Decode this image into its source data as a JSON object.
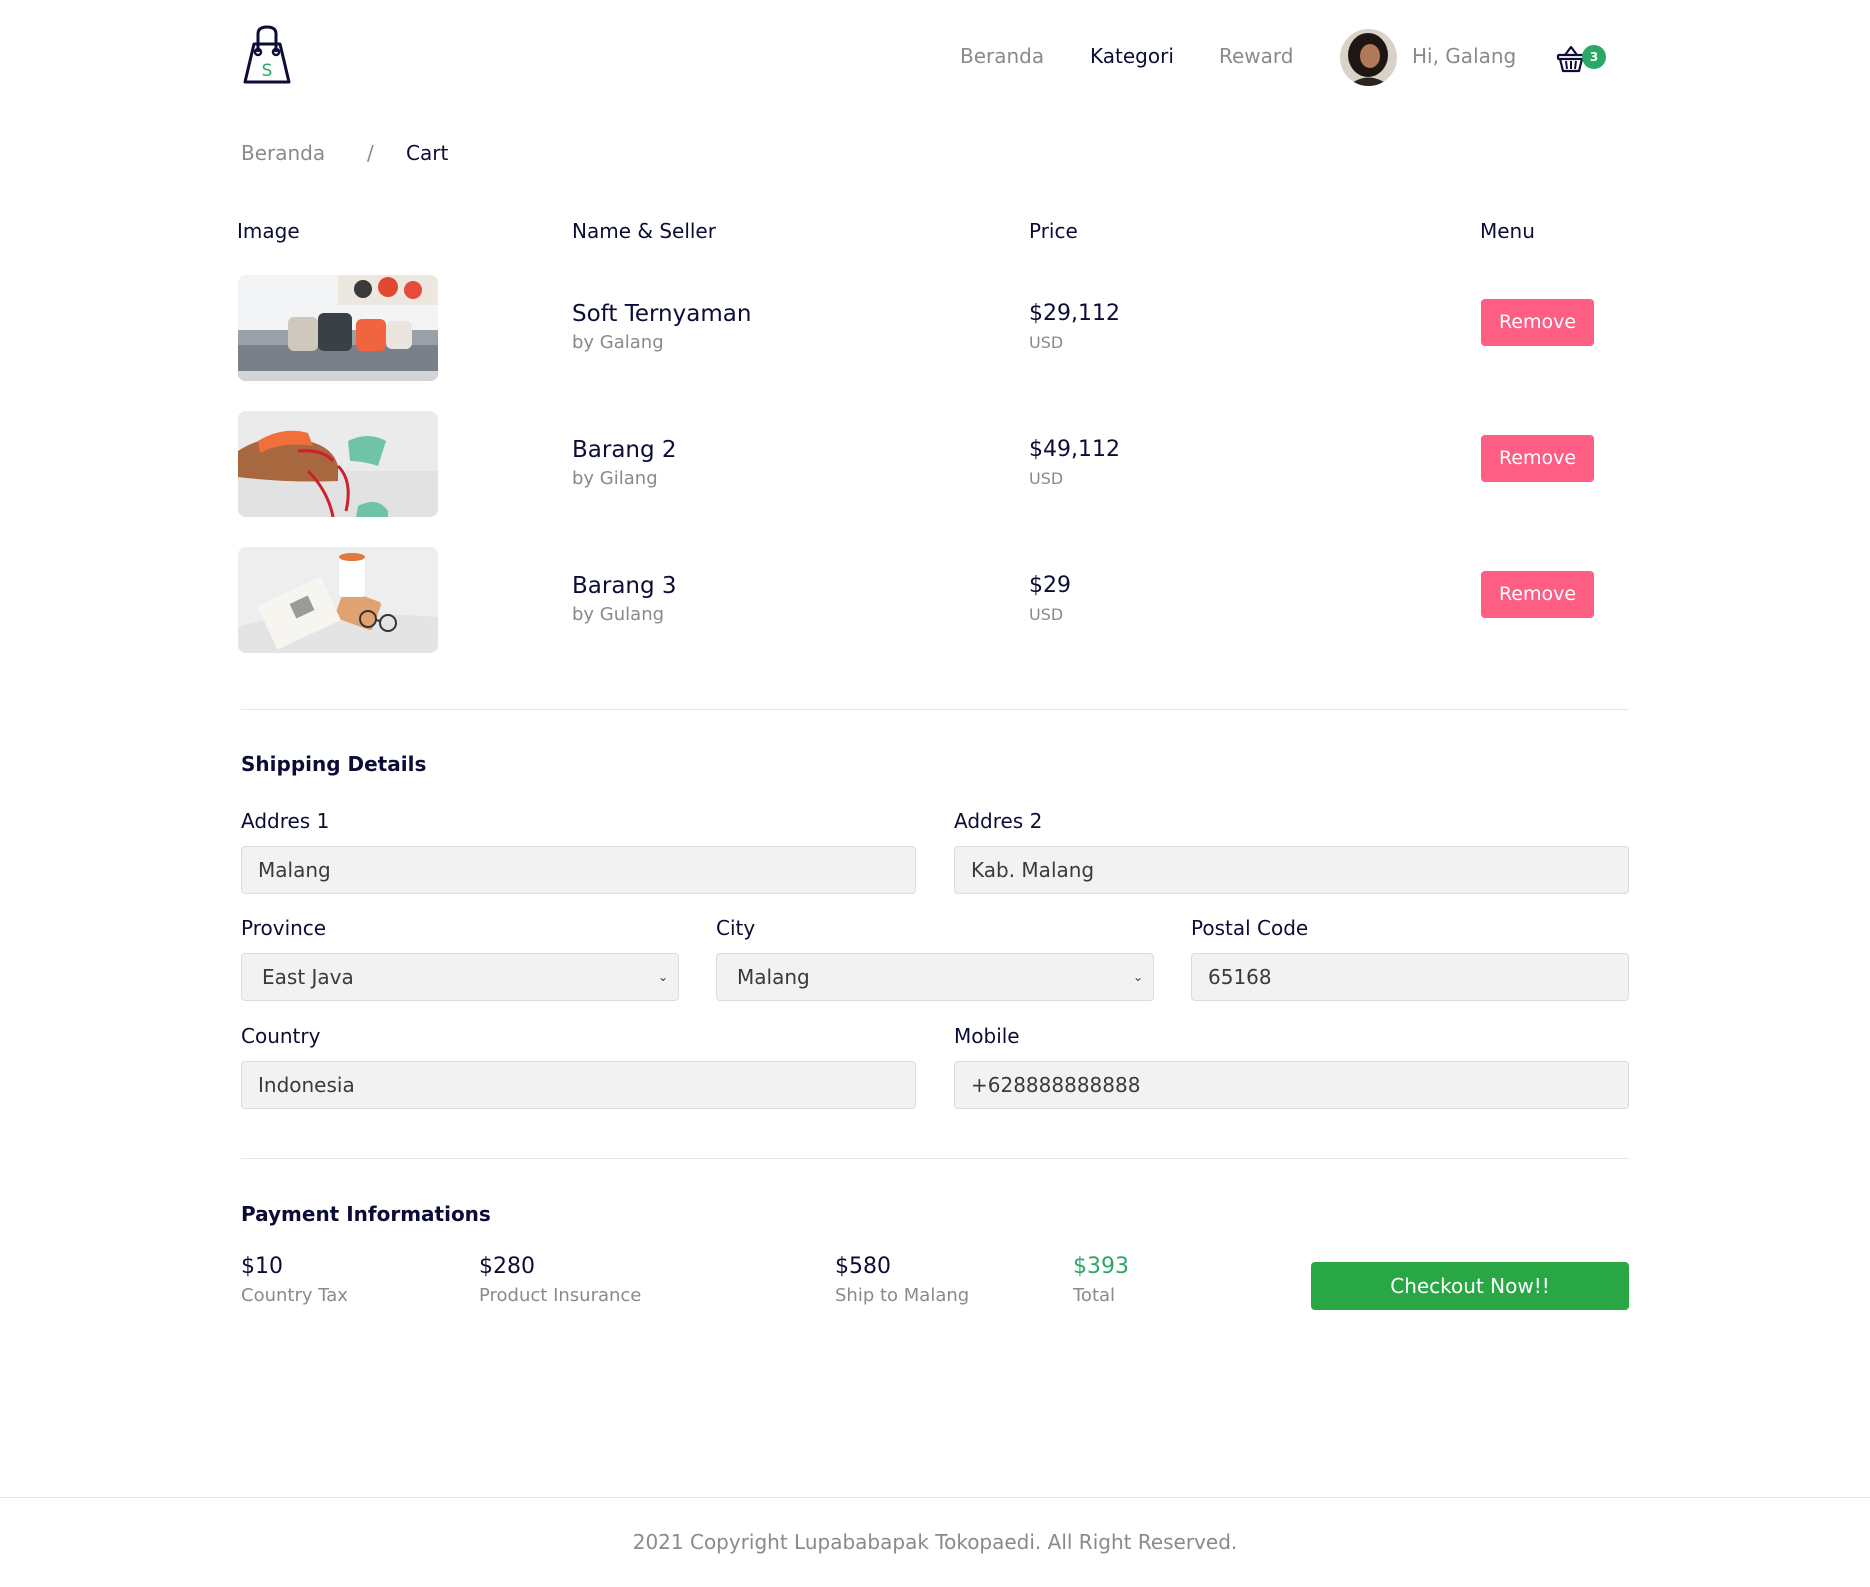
{
  "navbar": {
    "logo_letter": "S",
    "links": [
      {
        "label": "Beranda",
        "active": false
      },
      {
        "label": "Kategori",
        "active": true
      },
      {
        "label": "Reward",
        "active": false
      }
    ],
    "greeting": "Hi, Galang",
    "cart_count": "3"
  },
  "breadcrumb": {
    "home": "Beranda",
    "separator": "/",
    "current": "Cart"
  },
  "cart": {
    "headers": {
      "image": "Image",
      "name": "Name & Seller",
      "price": "Price",
      "menu": "Menu"
    },
    "items": [
      {
        "name": "Soft Ternyaman",
        "seller": "by Galang",
        "price": "$29,112",
        "currency": "USD",
        "action": "Remove",
        "image_icon": "sofa-photo"
      },
      {
        "name": "Barang 2",
        "seller": "by Gilang",
        "price": "$49,112",
        "currency": "USD",
        "action": "Remove",
        "image_icon": "sneaker-photo"
      },
      {
        "name": "Barang 3",
        "seller": "by Gulang",
        "price": "$29",
        "currency": "USD",
        "action": "Remove",
        "image_icon": "coffee-book-photo"
      }
    ]
  },
  "shipping": {
    "title": "Shipping Details",
    "address1": {
      "label": "Addres 1",
      "value": "Malang"
    },
    "address2": {
      "label": "Addres 2",
      "value": "Kab. Malang"
    },
    "province": {
      "label": "Province",
      "value": "East Java"
    },
    "city": {
      "label": "City",
      "value": "Malang"
    },
    "postal_code": {
      "label": "Postal Code",
      "value": "65168"
    },
    "country": {
      "label": "Country",
      "value": "Indonesia"
    },
    "mobile": {
      "label": "Mobile",
      "value": "+628888888888"
    }
  },
  "payment": {
    "title": "Payment Informations",
    "country_tax": {
      "value": "$10",
      "label": "Country Tax"
    },
    "insurance": {
      "value": "$280",
      "label": "Product Insurance"
    },
    "shipping": {
      "value": "$580",
      "label": "Ship to Malang"
    },
    "total": {
      "value": "$393",
      "label": "Total"
    },
    "checkout_label": "Checkout Now!!"
  },
  "footer": {
    "copyright": "2021 Copyright Lupababapak Tokopaedi. All Right Reserved."
  },
  "colors": {
    "brand_green": "#29a867",
    "checkout_green": "#29a745",
    "remove_pink": "#ff5e84",
    "text_dark": "#0c0d36",
    "text_muted": "#8a8a8a",
    "field_bg": "#f2f2f2"
  }
}
